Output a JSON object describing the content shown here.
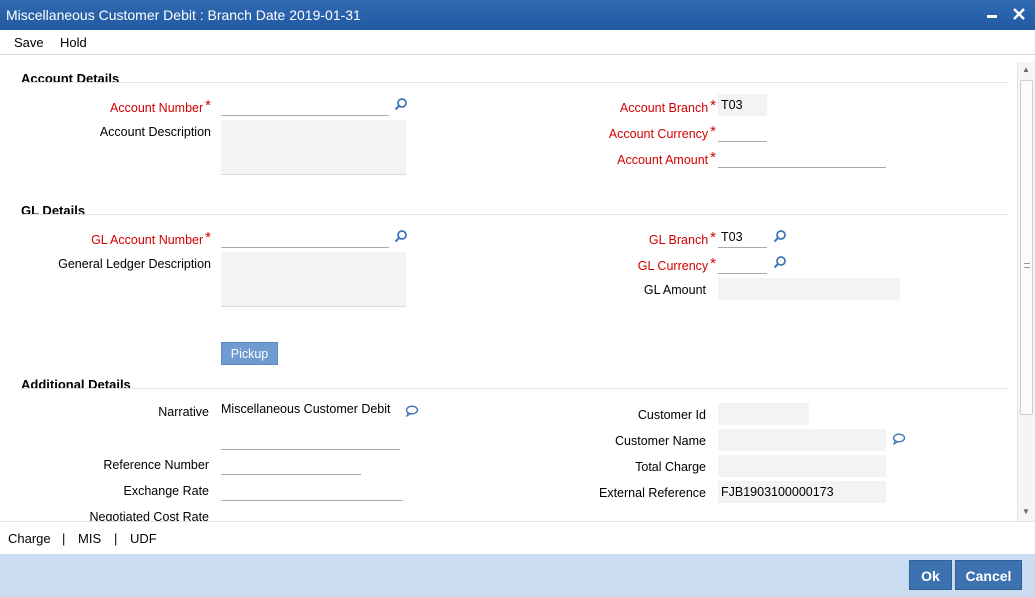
{
  "window": {
    "title": "Miscellaneous Customer Debit : Branch Date 2019-01-31",
    "minimize": "–",
    "close": "✕"
  },
  "toolbar": {
    "save": "Save",
    "hold": "Hold"
  },
  "account": {
    "section": "Account Details",
    "number_label": "Account Number",
    "number_value": "",
    "description_label": "Account Description",
    "branch_label": "Account Branch",
    "branch_value": "T03",
    "currency_label": "Account Currency",
    "currency_value": "",
    "amount_label": "Account Amount",
    "amount_value": ""
  },
  "gl": {
    "section": "GL Details",
    "number_label": "GL Account Number",
    "number_value": "",
    "description_label": "General Ledger Description",
    "branch_label": "GL Branch",
    "branch_value": "T03",
    "currency_label": "GL Currency",
    "currency_value": "",
    "amount_label": "GL Amount",
    "amount_value": "",
    "pickup": "Pickup"
  },
  "additional": {
    "section": "Additional Details",
    "narrative_label": "Narrative",
    "narrative_value": "Miscellaneous Customer Debit",
    "reference_label": "Reference Number",
    "exchange_label": "Exchange Rate",
    "negotiated_label": "Negotiated Cost Rate",
    "customer_id_label": "Customer Id",
    "customer_id_value": "",
    "customer_name_label": "Customer Name",
    "customer_name_value": "",
    "total_charge_label": "Total Charge",
    "total_charge_value": "",
    "external_ref_label": "External Reference",
    "external_ref_value": "FJB1903100000173"
  },
  "tabs": {
    "charge": "Charge",
    "mis": "MIS",
    "udf": "UDF",
    "separator": "|"
  },
  "footer": {
    "ok": "Ok",
    "cancel": "Cancel"
  },
  "colors": {
    "titlebar": "#2f6ab1",
    "required": "#d40000",
    "button": "#3c72b0",
    "footer": "#c9dcf0"
  }
}
